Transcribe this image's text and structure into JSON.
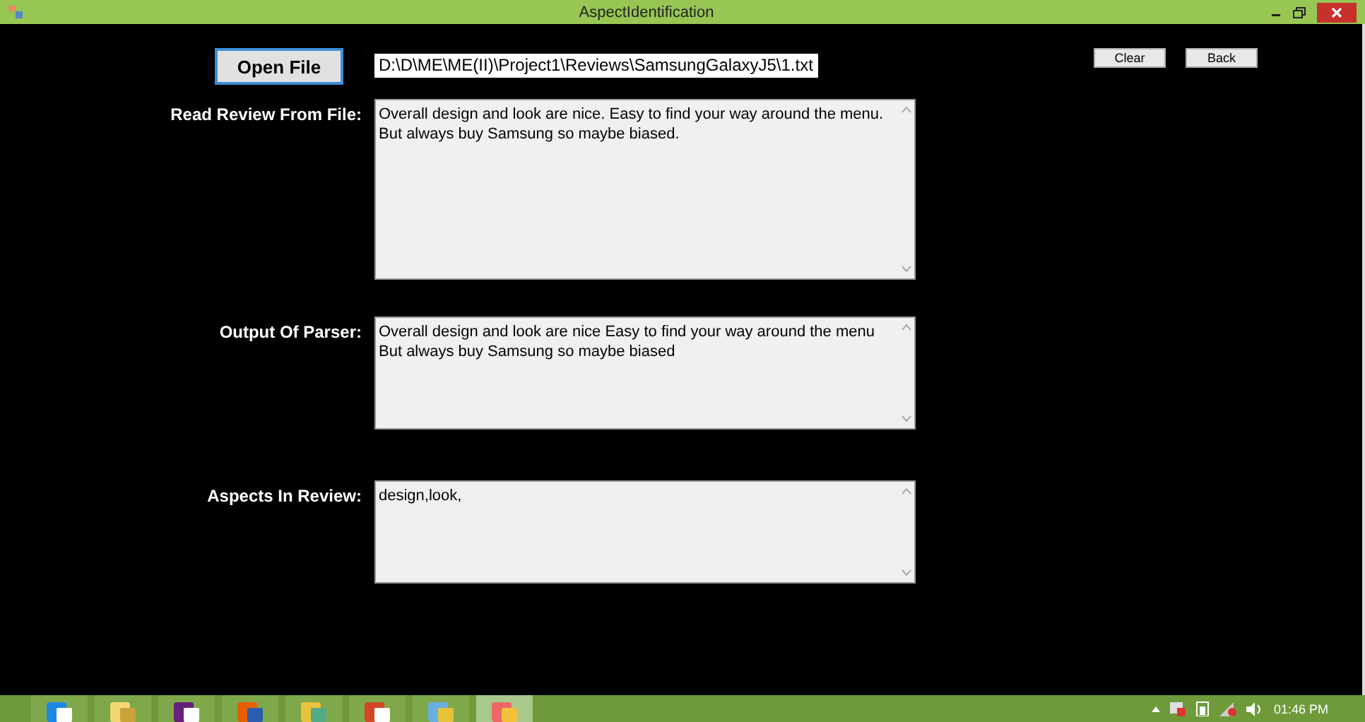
{
  "window": {
    "title": "AspectIdentification"
  },
  "toolbar": {
    "open_button": "Open File",
    "file_path": "D:\\D\\ME\\ME(II)\\Project1\\Reviews\\SamsungGalaxyJ5\\1.txt",
    "buttons": [
      "Clear",
      "Back"
    ]
  },
  "fields": [
    {
      "label": "Read Review From File:",
      "lines": [
        "Overall design and look are nice. Easy to find your way around the menu.",
        "But always buy Samsung so maybe biased."
      ]
    },
    {
      "label": "Output Of Parser:",
      "lines": [
        "Overall design and look are nice Easy to find your way around the menu",
        "But always buy Samsung so maybe biased"
      ]
    },
    {
      "label": "Aspects In Review:",
      "lines": [
        "design,look,"
      ]
    }
  ],
  "taskbar": {
    "apps": [
      {
        "kind": "browser",
        "selected": false
      },
      {
        "kind": "folder",
        "selected": false
      },
      {
        "kind": "studio",
        "selected": false
      },
      {
        "kind": "firefox",
        "selected": false
      },
      {
        "kind": "tool",
        "selected": false
      },
      {
        "kind": "slides",
        "selected": false
      },
      {
        "kind": "paint",
        "selected": false
      },
      {
        "kind": "app",
        "selected": true
      }
    ],
    "time": "01:46 PM"
  }
}
